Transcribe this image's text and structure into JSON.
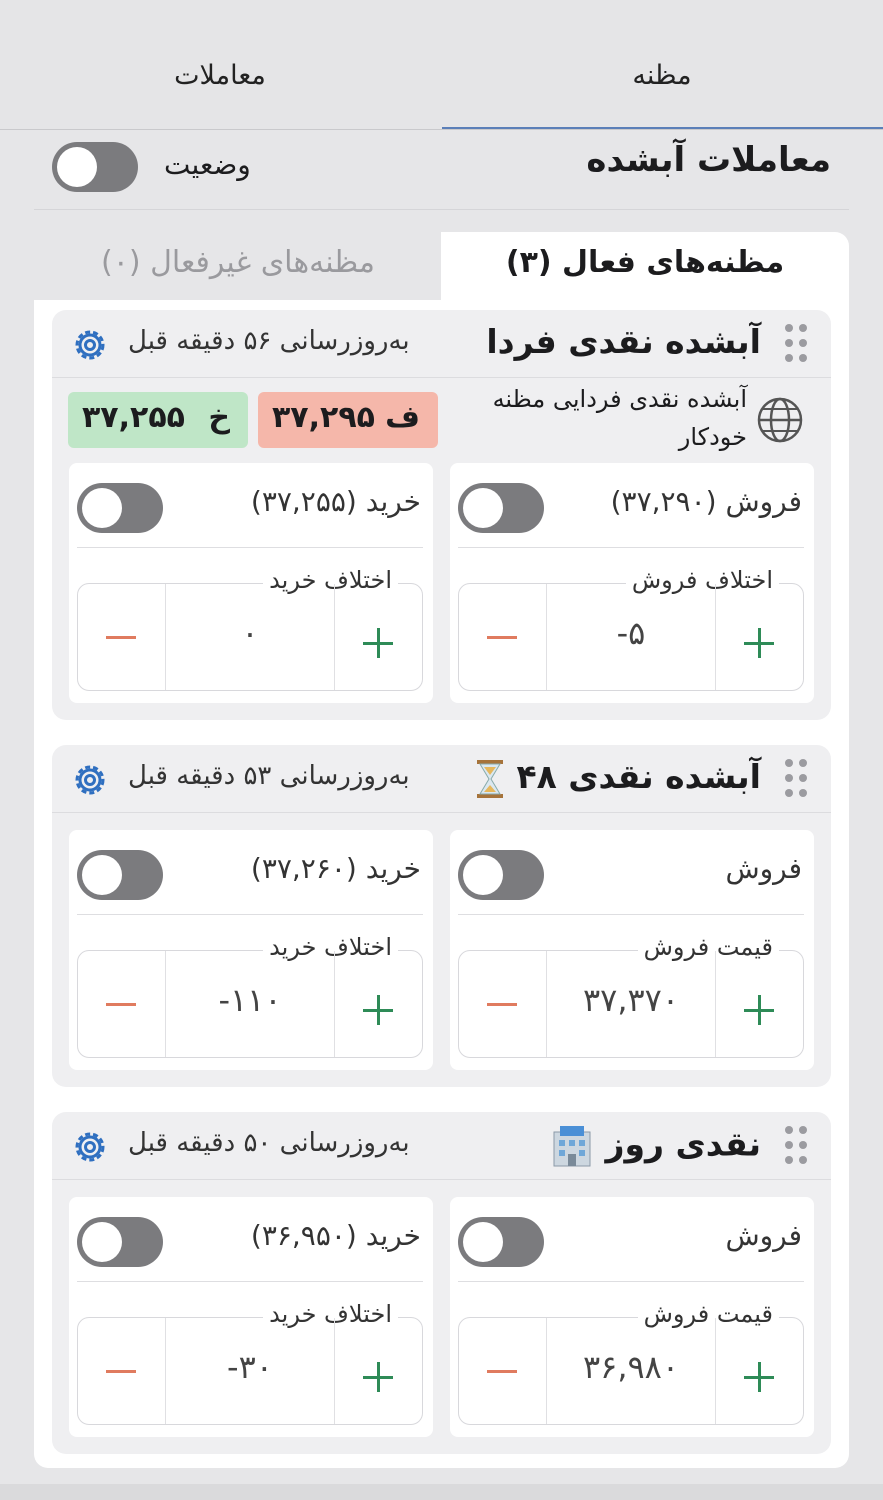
{
  "top_tabs": {
    "mazneh": "مظنه",
    "moamelat": "معاملات"
  },
  "header": {
    "title": "معاملات آبشده",
    "status_label": "وضعیت"
  },
  "segments": {
    "active": "مظنه‌های فعال (۳)",
    "inactive": "مظنه‌های غیرفعال (۰)"
  },
  "cards": [
    {
      "title": "آبشده نقدی فردا",
      "updated": "به‌روزرسانی ۵۶ دقیقه قبل",
      "source": "آبشده نقدی فردایی مظنه خودکار",
      "sell_chip": {
        "letter": "ف",
        "value": "۳۷,۲۹۵"
      },
      "buy_chip": {
        "letter": "خ",
        "value": "۳۷,۲۵۵"
      },
      "sell": {
        "label": "فروش (۳۷,۲۹۰)",
        "stepper_label": "اختلاف فروش",
        "value": "-۵"
      },
      "buy": {
        "label": "خرید (۳۷,۲۵۵)",
        "stepper_label": "اختلاف خرید",
        "value": "۰"
      }
    },
    {
      "title": "آبشده نقدی ۴۸",
      "updated": "به‌روزرسانی ۵۳ دقیقه قبل",
      "sell": {
        "label": "فروش",
        "stepper_label": "قیمت فروش",
        "value": "۳۷,۳۷۰"
      },
      "buy": {
        "label": "خرید (۳۷,۲۶۰)",
        "stepper_label": "اختلاف خرید",
        "value": "-۱۱۰"
      }
    },
    {
      "title": "نقدی روز",
      "updated": "به‌روزرسانی ۵۰ دقیقه قبل",
      "sell": {
        "label": "فروش",
        "stepper_label": "قیمت فروش",
        "value": "۳۶,۹۸۰"
      },
      "buy": {
        "label": "خرید (۳۶,۹۵۰)",
        "stepper_label": "اختلاف خرید",
        "value": "-۳۰"
      }
    }
  ],
  "colors": {
    "accent": "#5b7fb8",
    "sell_chip": "#f5b7aa",
    "buy_chip": "#bfe6c7",
    "plus": "#2e8b57",
    "minus": "#e07b5f"
  },
  "icons": [
    "gear-icon",
    "drag-handle-icon",
    "globe-icon",
    "hourglass-icon",
    "bank-icon",
    "plus-icon",
    "minus-icon"
  ]
}
